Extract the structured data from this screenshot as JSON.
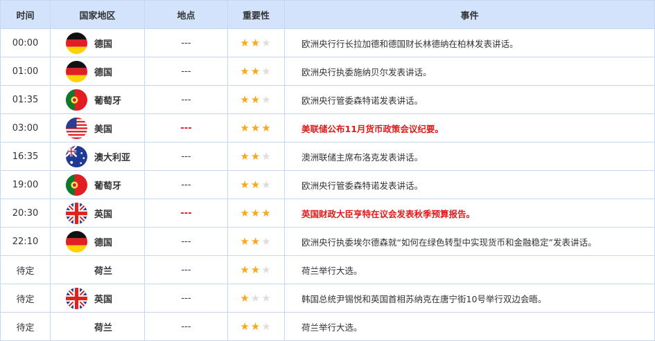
{
  "headers": [
    "时间",
    "国家地区",
    "地点",
    "重要性",
    "事件"
  ],
  "rows": [
    {
      "time": "00:00",
      "flag": "de",
      "country": "德国",
      "place": "---",
      "stars": 2,
      "event": "欧洲央行行长拉加德和德国财长林德纳在柏林发表讲话。",
      "highlight": false
    },
    {
      "time": "01:00",
      "flag": "de",
      "country": "德国",
      "place": "---",
      "stars": 2,
      "event": "欧洲央行执委施纳贝尔发表讲话。",
      "highlight": false
    },
    {
      "time": "01:35",
      "flag": "pt",
      "country": "葡萄牙",
      "place": "---",
      "stars": 2,
      "event": "欧洲央行管委森特诺发表讲话。",
      "highlight": false
    },
    {
      "time": "03:00",
      "flag": "us",
      "country": "美国",
      "place": "---",
      "stars": 3,
      "event": "美联储公布11月货币政策会议纪要。",
      "highlight": true
    },
    {
      "time": "16:35",
      "flag": "au",
      "country": "澳大利亚",
      "place": "---",
      "stars": 2,
      "event": "澳洲联储主席布洛克发表讲话。",
      "highlight": false
    },
    {
      "time": "19:00",
      "flag": "pt",
      "country": "葡萄牙",
      "place": "---",
      "stars": 2,
      "event": "欧洲央行管委森特诺发表讲话。",
      "highlight": false
    },
    {
      "time": "20:30",
      "flag": "gb",
      "country": "英国",
      "place": "---",
      "stars": 3,
      "event": "英国财政大臣亨特在议会发表秋季预算报告。",
      "highlight": true
    },
    {
      "time": "22:10",
      "flag": "de",
      "country": "德国",
      "place": "---",
      "stars": 2,
      "event": "欧洲央行执委埃尔德森就“如何在绿色转型中实现货币和金融稳定”发表讲话。",
      "highlight": false
    },
    {
      "time": "待定",
      "flag": "",
      "country": "荷兰",
      "place": "---",
      "stars": 2,
      "event": "荷兰举行大选。",
      "highlight": false
    },
    {
      "time": "待定",
      "flag": "gb",
      "country": "英国",
      "place": "---",
      "stars": 1,
      "event": "韩国总统尹锡悦和英国首相苏纳克在唐宁街10号举行双边会晤。",
      "highlight": false
    },
    {
      "time": "待定",
      "flag": "",
      "country": "荷兰",
      "place": "---",
      "stars": 2,
      "event": "荷兰举行大选。",
      "highlight": false
    }
  ]
}
